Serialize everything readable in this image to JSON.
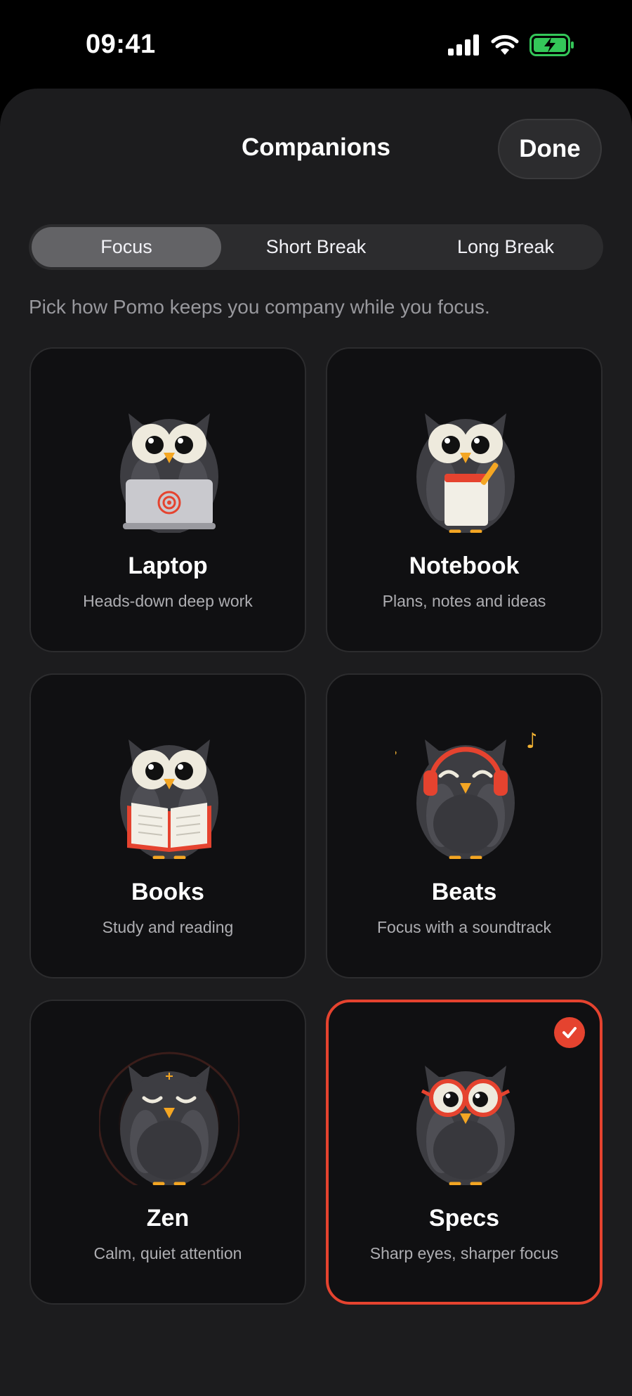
{
  "status_bar": {
    "time": "09:41",
    "icons": [
      "cellular-signal-icon",
      "wifi-icon",
      "battery-charging-icon"
    ]
  },
  "sheet": {
    "title": "Companions",
    "done_label": "Done"
  },
  "tabs": [
    {
      "label": "Focus",
      "active": true
    },
    {
      "label": "Short Break",
      "active": false
    },
    {
      "label": "Long Break",
      "active": false
    }
  ],
  "subtitle": "Pick how Pomo keeps you company while you focus.",
  "companions": [
    {
      "name": "Laptop",
      "desc": "Heads-down deep work",
      "selected": false
    },
    {
      "name": "Notebook",
      "desc": "Plans, notes and ideas",
      "selected": false
    },
    {
      "name": "Books",
      "desc": "Study and reading",
      "selected": false
    },
    {
      "name": "Beats",
      "desc": "Focus with a soundtrack",
      "selected": false
    },
    {
      "name": "Zen",
      "desc": "Calm, quiet attention",
      "selected": false
    },
    {
      "name": "Specs",
      "desc": "Sharp eyes, sharper focus",
      "selected": true
    }
  ],
  "colors": {
    "accent": "#e5432f",
    "background": "#1c1c1e",
    "card": "#101012",
    "battery": "#34c759",
    "music_note": "#f2b233"
  }
}
